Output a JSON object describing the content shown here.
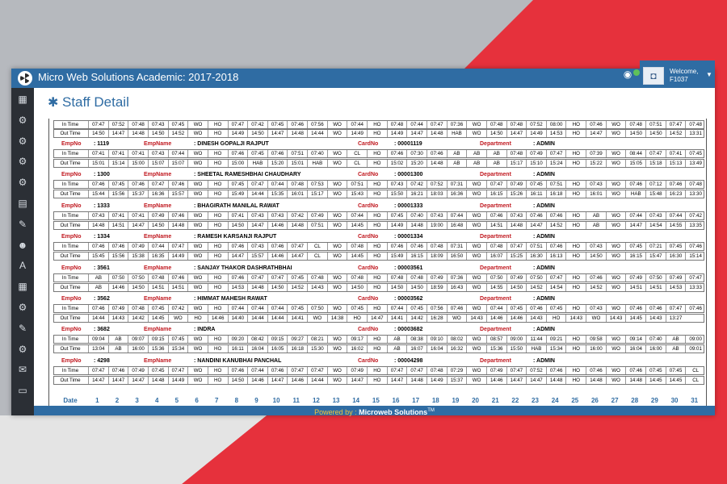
{
  "app": {
    "title": "Micro Web Solutions Academic: 2017-2018",
    "welcome": "Welcome,",
    "user_id": "F1037",
    "page_title": "Staff Detail",
    "footer_powered": "Powered by :",
    "footer_company": "Microweb Solutions",
    "footer_tm": "TM"
  },
  "labels": {
    "in_time": "In Time",
    "out_time": "Out Time",
    "empno": "EmpNo",
    "empname": "EmpName",
    "cardno": "CardNo",
    "department": "Department",
    "date": "Date"
  },
  "sidebar": {
    "icons": [
      "table-icon",
      "gears-icon",
      "gears-icon",
      "gears-icon",
      "gears-icon",
      "calendar-icon",
      "edit-icon",
      "users-icon",
      "font-icon",
      "table-icon",
      "gears-icon",
      "edit-icon",
      "gears-icon",
      "envelope-icon",
      "card-icon"
    ]
  },
  "colors": {
    "accent": "#2f6ca3",
    "label_red": "#c0181f",
    "powered_yellow": "#f1c33c",
    "sidebar": "#2b2f35"
  },
  "days": [
    "1",
    "2",
    "3",
    "4",
    "5",
    "6",
    "7",
    "8",
    "9",
    "10",
    "11",
    "12",
    "13",
    "14",
    "15",
    "16",
    "17",
    "18",
    "19",
    "20",
    "21",
    "22",
    "23",
    "24",
    "25",
    "26",
    "27",
    "28",
    "29",
    "30",
    "31"
  ],
  "top_rows": {
    "in": [
      "07:47",
      "07:52",
      "07:48",
      "07:43",
      "07:45",
      "WO",
      "HO",
      "07:47",
      "07:42",
      "07:45",
      "07:46",
      "07:56",
      "WO",
      "07:44",
      "HO",
      "07:48",
      "07:44",
      "07:47",
      "07:36",
      "WO",
      "07:48",
      "07:48",
      "07:52",
      "08:00",
      "HO",
      "07:46",
      "WO",
      "07:48",
      "07:51",
      "07:47",
      "07:48"
    ],
    "out": [
      "14:50",
      "14:47",
      "14:48",
      "14:50",
      "14:52",
      "WO",
      "HO",
      "14:49",
      "14:50",
      "14:47",
      "14:48",
      "14:44",
      "WO",
      "14:49",
      "HO",
      "14:49",
      "14:47",
      "14:48",
      "HAB",
      "WO",
      "14:50",
      "14:47",
      "14:49",
      "14:53",
      "HO",
      "14:47",
      "WO",
      "14:50",
      "14:50",
      "14:52",
      "13:31"
    ]
  },
  "employees": [
    {
      "empno": ": 1119",
      "name": ": DINESH GOPALJI RAJPUT",
      "card": ": 00001119",
      "dept": ": ADMIN",
      "in": [
        "07:41",
        "07:41",
        "07:41",
        "07:43",
        "07:44",
        "WO",
        "HO",
        "07:46",
        "07:45",
        "07:46",
        "07:51",
        "07:40",
        "WO",
        "CL",
        "HO",
        "07:46",
        "07:30",
        "07:46",
        "AB",
        "AB",
        "AB",
        "07:48",
        "07:49",
        "07:47",
        "HO",
        "07:39",
        "WO",
        "08:44",
        "07:47",
        "07:41",
        "07:45"
      ],
      "out": [
        "15:01",
        "15:14",
        "15:00",
        "15:07",
        "15:07",
        "WO",
        "HO",
        "15:00",
        "HAB",
        "15:20",
        "15:01",
        "HAB",
        "WO",
        "CL",
        "HO",
        "15:02",
        "15:20",
        "14:48",
        "AB",
        "AB",
        "AB",
        "15:17",
        "15:10",
        "15:24",
        "HO",
        "15:22",
        "WO",
        "15:05",
        "15:18",
        "15:13",
        "13:49"
      ]
    },
    {
      "empno": ": 1300",
      "name": ": SHEETAL RAMESHBHAI CHAUDHARY",
      "card": ": 00001300",
      "dept": ": ADMIN",
      "in": [
        "07:46",
        "07:45",
        "07:46",
        "07:47",
        "07:46",
        "WO",
        "HO",
        "07:45",
        "07:47",
        "07:44",
        "07:48",
        "07:53",
        "WO",
        "07:51",
        "HO",
        "07:43",
        "07:42",
        "07:52",
        "07:31",
        "WO",
        "07:47",
        "07:49",
        "07:45",
        "07:51",
        "HO",
        "07:43",
        "WO",
        "07:46",
        "07:12",
        "07:46",
        "07:48"
      ],
      "out": [
        "15:44",
        "15:56",
        "15:37",
        "16:36",
        "15:57",
        "WO",
        "HO",
        "15:49",
        "14:44",
        "15:35",
        "16:01",
        "15:17",
        "WO",
        "15:43",
        "HO",
        "15:50",
        "16:21",
        "18:03",
        "16:36",
        "WO",
        "16:15",
        "15:26",
        "16:11",
        "16:18",
        "HO",
        "16:01",
        "WO",
        "HAB",
        "15:48",
        "16:23",
        "13:30"
      ]
    },
    {
      "empno": ": 1333",
      "name": ": BHAGIRATH MANILAL RAWAT",
      "card": ": 00001333",
      "dept": ": ADMIN",
      "in": [
        "07:43",
        "07:41",
        "07:41",
        "07:49",
        "07:46",
        "WO",
        "HO",
        "07:41",
        "07:43",
        "07:43",
        "07:42",
        "07:49",
        "WO",
        "07:44",
        "HO",
        "07:45",
        "07:40",
        "07:43",
        "07:44",
        "WO",
        "07:46",
        "07:43",
        "07:46",
        "07:46",
        "HO",
        "AB",
        "WO",
        "07:44",
        "07:43",
        "07:44",
        "07:42"
      ],
      "out": [
        "14:48",
        "14:51",
        "14:47",
        "14:50",
        "14:48",
        "WO",
        "HO",
        "14:50",
        "14:47",
        "14:46",
        "14:48",
        "07:51",
        "WO",
        "14:45",
        "HO",
        "14:49",
        "14:48",
        "19:00",
        "16:48",
        "WO",
        "14:51",
        "14:48",
        "14:47",
        "14:52",
        "HO",
        "AB",
        "WO",
        "14:47",
        "14:54",
        "14:55",
        "13:35"
      ]
    },
    {
      "empno": ": 1334",
      "name": ": RAMESH KARSANJI RAJPUT",
      "card": ": 00001334",
      "dept": ": ADMIN",
      "in": [
        "07:46",
        "07:46",
        "07:49",
        "07:44",
        "07:47",
        "WO",
        "HO",
        "07:46",
        "07:43",
        "07:46",
        "07:47",
        "CL",
        "WO",
        "07:48",
        "HO",
        "07:46",
        "07:46",
        "07:48",
        "07:31",
        "WO",
        "07:48",
        "07:47",
        "07:51",
        "07:46",
        "HO",
        "07:43",
        "WO",
        "07:45",
        "07:21",
        "07:45",
        "07:46"
      ],
      "out": [
        "15:45",
        "15:56",
        "15:38",
        "16:35",
        "14:49",
        "WO",
        "HO",
        "14:47",
        "15:57",
        "14:46",
        "14:47",
        "CL",
        "WO",
        "14:45",
        "HO",
        "15:49",
        "16:15",
        "18:09",
        "16:50",
        "WO",
        "16:07",
        "15:25",
        "16:30",
        "16:13",
        "HO",
        "14:50",
        "WO",
        "16:15",
        "15:47",
        "16:30",
        "15:14"
      ]
    },
    {
      "empno": ": 3561",
      "name": ": SANJAY THAKOR DASHRATHBHAI",
      "card": ": 00003561",
      "dept": ": ADMIN",
      "in": [
        "AB",
        "07:50",
        "07:50",
        "07:48",
        "07:46",
        "WO",
        "HO",
        "07:46",
        "07:47",
        "07:47",
        "07:45",
        "07:48",
        "WO",
        "07:48",
        "HO",
        "07:48",
        "07:48",
        "07:49",
        "07:36",
        "WO",
        "07:50",
        "07:49",
        "07:50",
        "07:47",
        "HO",
        "07:46",
        "WO",
        "07:49",
        "07:50",
        "07:49",
        "07:47"
      ],
      "out": [
        "AB",
        "14:46",
        "14:50",
        "14:51",
        "14:51",
        "WO",
        "HO",
        "14:53",
        "14:48",
        "14:50",
        "14:52",
        "14:43",
        "WO",
        "14:50",
        "HO",
        "14:50",
        "14:50",
        "18:59",
        "16:43",
        "WO",
        "14:55",
        "14:50",
        "14:52",
        "14:54",
        "HO",
        "14:52",
        "WO",
        "14:51",
        "14:51",
        "14:53",
        "13:33"
      ]
    },
    {
      "empno": ": 3562",
      "name": ": HIMMAT MAHESH RAWAT",
      "card": ": 00003562",
      "dept": ": ADMIN",
      "in": [
        "07:46",
        "07:49",
        "07:48",
        "07:45",
        "07:42",
        "WO",
        "HO",
        "07:44",
        "07:44",
        "07:44",
        "07:45",
        "07:50",
        "WO",
        "07:45",
        "HO",
        "07:44",
        "07:45",
        "07:56",
        "07:46",
        "WO",
        "07:44",
        "07:45",
        "07:46",
        "07:45",
        "HO",
        "07:43",
        "WO",
        "07:46",
        "07:46",
        "07:47",
        "07:46"
      ],
      "out": [
        "14:44",
        "14:43",
        "14:42",
        "14:45",
        "WO",
        "HO",
        "14:46",
        "14:40",
        "14:44",
        "14:44",
        "14:41",
        "WO",
        "14:38",
        "HO",
        "14:47",
        "14:41",
        "14:42",
        "16:28",
        "WO",
        "14:43",
        "14:46",
        "14:46",
        "14:43",
        "HO",
        "14:43",
        "WO",
        "14:43",
        "14:45",
        "14:43",
        "13:27"
      ]
    },
    {
      "empno": ": 3682",
      "name": ": INDRA",
      "card": ": 00003682",
      "dept": ": ADMIN",
      "in": [
        "09:04",
        "AB",
        "09:07",
        "09:15",
        "07:45",
        "WO",
        "HO",
        "09:20",
        "08:42",
        "09:15",
        "09:27",
        "08:21",
        "WO",
        "09:17",
        "HO",
        "AB",
        "08:38",
        "09:10",
        "08:02",
        "WO",
        "08:57",
        "09:00",
        "11:44",
        "09:21",
        "HO",
        "09:58",
        "WO",
        "09:14",
        "07:40",
        "AB",
        "09:00"
      ],
      "out": [
        "13:04",
        "AB",
        "16:00",
        "15:36",
        "15:34",
        "WO",
        "HO",
        "16:11",
        "16:04",
        "16:05",
        "16:18",
        "15:30",
        "WO",
        "16:02",
        "HO",
        "AB",
        "16:07",
        "16:04",
        "16:32",
        "WO",
        "15:36",
        "15:50",
        "HAB",
        "15:34",
        "HO",
        "16:00",
        "WO",
        "16:04",
        "16:00",
        "AB",
        "09:01"
      ]
    },
    {
      "empno": ": 4298",
      "name": ": NANDINI KANUBHAI PANCHAL",
      "card": ": 00004298",
      "dept": ": ADMIN",
      "in": [
        "07:47",
        "07:46",
        "07:49",
        "07:45",
        "07:47",
        "WO",
        "HO",
        "07:46",
        "07:44",
        "07:46",
        "07:47",
        "07:47",
        "WO",
        "07:49",
        "HO",
        "07:47",
        "07:47",
        "07:48",
        "07:29",
        "WO",
        "07:49",
        "07:47",
        "07:52",
        "07:46",
        "HO",
        "07:46",
        "WO",
        "07:46",
        "07:45",
        "07:45",
        "CL"
      ],
      "out": [
        "14:47",
        "14:47",
        "14:47",
        "14:48",
        "14:49",
        "WO",
        "HO",
        "14:50",
        "14:46",
        "14:47",
        "14:46",
        "14:44",
        "WO",
        "14:47",
        "HO",
        "14:47",
        "14:48",
        "14:49",
        "15:37",
        "WO",
        "14:46",
        "14:47",
        "14:47",
        "14:48",
        "HO",
        "14:48",
        "WO",
        "14:48",
        "14:45",
        "14:45",
        "CL"
      ]
    }
  ]
}
